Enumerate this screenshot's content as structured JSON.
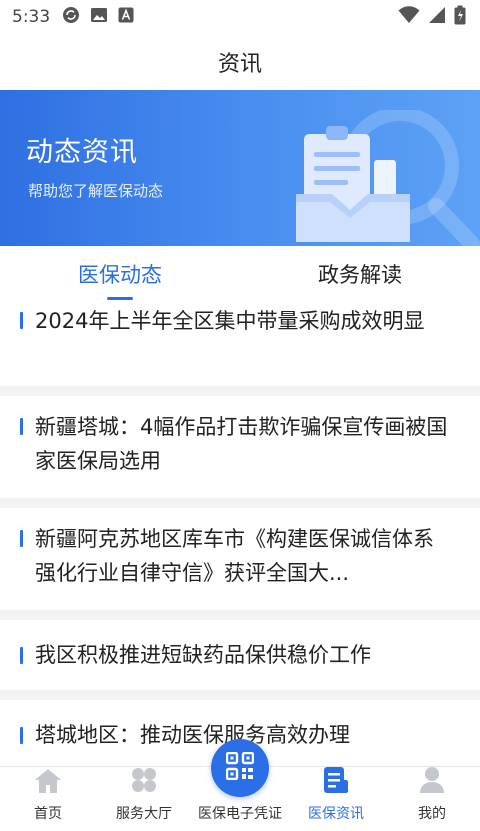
{
  "status_bar": {
    "time": "5:33"
  },
  "header": {
    "title": "资讯"
  },
  "banner": {
    "title": "动态资讯",
    "subtitle": "帮助您了解医保动态"
  },
  "tabs": [
    {
      "label": "医保动态",
      "active": true
    },
    {
      "label": "政务解读",
      "active": false
    }
  ],
  "news": [
    {
      "title": "2024年上半年全区集中带量采购成效明显"
    },
    {
      "title": "新疆塔城：4幅作品打击欺诈骗保宣传画被国家医保局选用"
    },
    {
      "title": "新疆阿克苏地区库车市《构建医保诚信体系 强化行业自律守信》获评全国大..."
    },
    {
      "title": "我区积极推进短缺药品保供稳价工作"
    },
    {
      "title": "塔城地区：推动医保服务高效办理"
    }
  ],
  "bottom_nav": [
    {
      "label": "首页",
      "icon": "home-icon"
    },
    {
      "label": "服务大厅",
      "icon": "grid-icon"
    },
    {
      "label": "医保电子凭证",
      "icon": "qr-code-icon"
    },
    {
      "label": "医保资讯",
      "icon": "news-icon",
      "active": true
    },
    {
      "label": "我的",
      "icon": "user-icon"
    }
  ],
  "colors": {
    "accent": "#2b6fe6",
    "banner_start": "#2f6fe2",
    "banner_end": "#5da2f5"
  }
}
